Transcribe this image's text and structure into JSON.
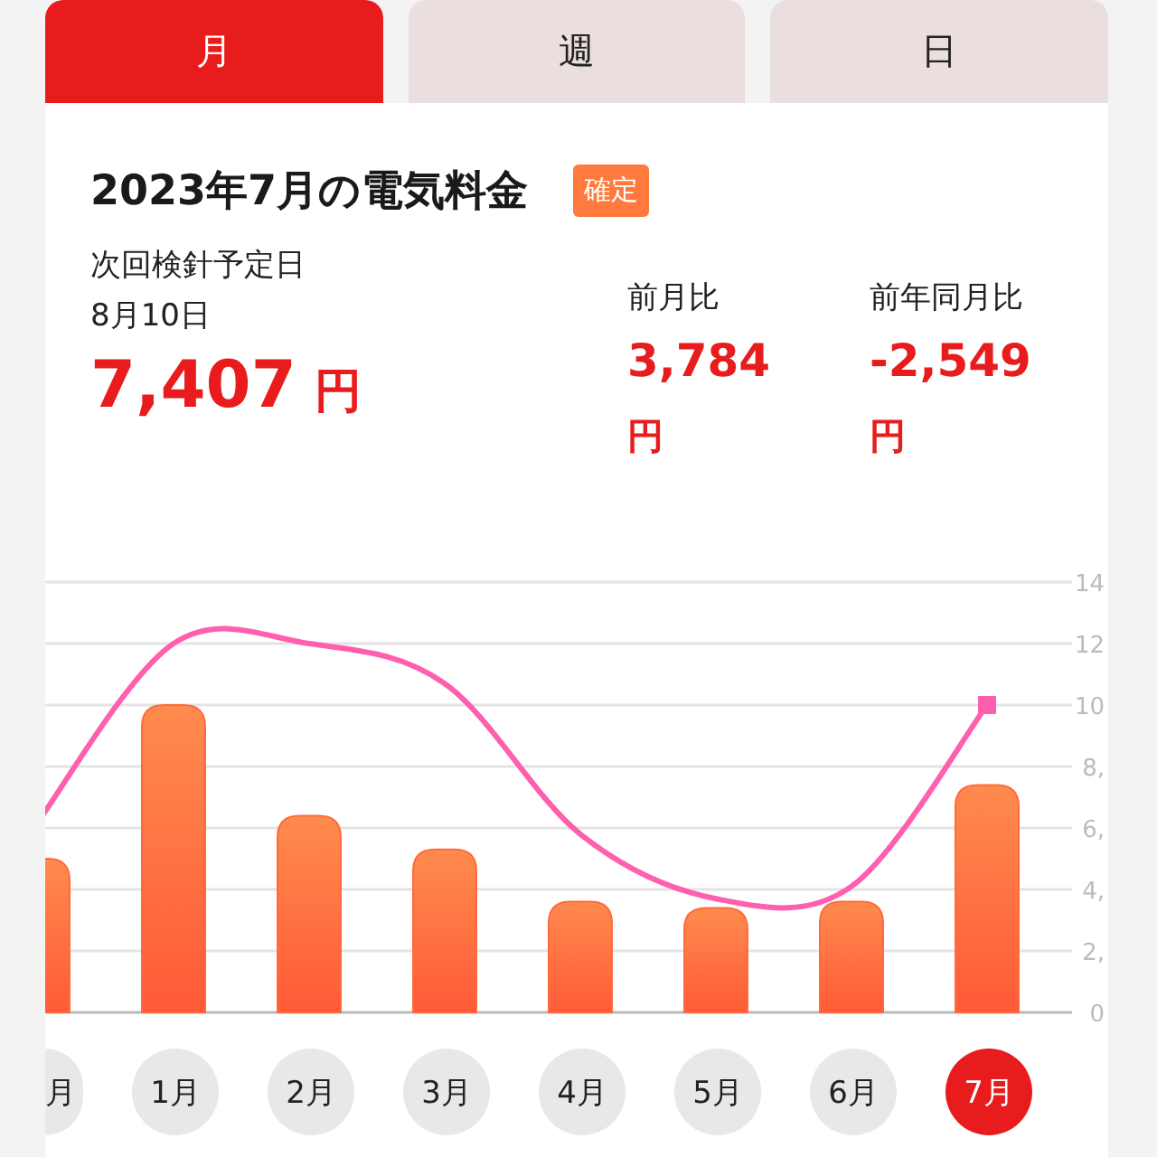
{
  "tabs": [
    {
      "label": "月",
      "selected": true
    },
    {
      "label": "週",
      "selected": false
    },
    {
      "label": "日",
      "selected": false
    }
  ],
  "summary": {
    "title": "2023年7月の電気料金",
    "badge": "確定",
    "next_reading_label": "次回検針予定日",
    "next_reading_date": "8月10日",
    "amount": "7,407",
    "amount_unit": "円",
    "comparisons": [
      {
        "label": "前月比",
        "value": "3,784",
        "unit": "円"
      },
      {
        "label": "前年同月比",
        "value": "-2,549",
        "unit": "円"
      }
    ]
  },
  "chart_data": {
    "type": "bar",
    "ylim": [
      0,
      14
    ],
    "grid": true,
    "categories": [
      null,
      "1月",
      "2月",
      "3月",
      "4月",
      "5月",
      "6月",
      "7月"
    ],
    "yticks": [
      0,
      {
        "value": 2,
        "label": "2,"
      },
      {
        "value": 4,
        "label": "4,"
      },
      {
        "value": 6,
        "label": "6,"
      },
      {
        "value": 8,
        "label": "8,"
      },
      10,
      12,
      14
    ],
    "series": [
      {
        "type": "bar",
        "color": "#ff6a3d",
        "values": [
          5,
          10,
          6.4,
          5.3,
          3.6,
          3.4,
          3.6,
          7.4
        ]
      },
      {
        "type": "line",
        "color": "#ff5fae",
        "values": [
          6.2,
          12,
          12,
          10.7,
          5.8,
          3.7,
          4.1,
          10
        ]
      }
    ]
  },
  "months": [
    {
      "label": "月",
      "selected": false,
      "kind": "partial"
    },
    {
      "selected": false
    },
    {
      "selected": false
    },
    {
      "selected": false
    },
    {
      "selected": false
    },
    {
      "selected": false
    },
    {
      "selected": false
    },
    {
      "selected": true
    }
  ]
}
